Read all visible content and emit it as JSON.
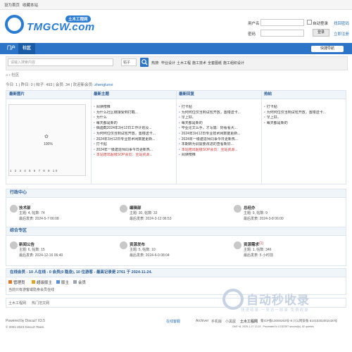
{
  "topbar": {
    "set_home": "设为首页",
    "bookmark": "收藏本站"
  },
  "logo": {
    "text": "TMGCW.com",
    "badge": "土木工程网"
  },
  "login": {
    "username_label": "用户名",
    "password_label": "密码",
    "auto_login": "自动登录",
    "find_password": "找回密码",
    "login_button": "登录",
    "register": "立即注册"
  },
  "nav": {
    "items": [
      "门户",
      "社区"
    ],
    "active": 1,
    "quick_nav": "快捷导航"
  },
  "search": {
    "placeholder": "请输入搜索内容",
    "select_value": "帖子",
    "hot_label": "热搜:",
    "hot_terms": [
      "毕业设计",
      "土木工程",
      "施工技术",
      "全套图纸",
      "施工组织设计"
    ]
  },
  "breadcrumb": {
    "current": "社区"
  },
  "stats": {
    "text": "今日: 1 | 昨日: 0 | 帖子: 493 | 会员: 34 | 欢迎新会员: ",
    "new_member": "zhenglunvi"
  },
  "top_panel": {
    "columns": [
      "最新图片",
      "最新主题",
      "最新回复",
      "热帖"
    ],
    "image_percent": "100%",
    "image_pages": "1 2 3 4 5 6 7 8 9 10",
    "latest_topics": [
      {
        "text": "阅读榜推",
        "red": false
      },
      {
        "text": "为什么社区链接受到打截...",
        "red": false
      },
      {
        "text": "为什么",
        "red": false
      },
      {
        "text": "每天都是新的",
        "red": false
      },
      {
        "text": "偶遇截2024年3月12日工作计划及...",
        "red": false
      },
      {
        "text": "为何何位仅当到试包开放，置楼送卡...",
        "red": false
      },
      {
        "text": "2024年3月12日专业技术网数据更新...",
        "red": false
      },
      {
        "text": "打卡贴",
        "red": false
      },
      {
        "text": "2024年一级建造师同事今日更新热...",
        "red": false
      },
      {
        "text": "本站陪出超级SOP会员：全站资源...",
        "red": true
      }
    ],
    "latest_replies": [
      {
        "text": "打卡贴",
        "red": false
      },
      {
        "text": "为何何位仅当到试包开放，置楼送卡...",
        "red": false
      },
      {
        "text": "早上好。",
        "red": false
      },
      {
        "text": "每天都是新的",
        "red": false
      },
      {
        "text": "毕业论文么手，才写篇：好看看大...",
        "red": false
      },
      {
        "text": "2024年3月12日专业技术网数据更新...",
        "red": false
      },
      {
        "text": "2024年一级建造师同事今日更新热...",
        "red": false
      },
      {
        "text": "本期转为调需要改进的查看新好...",
        "red": false
      },
      {
        "text": "本站陪出超级SOP会员：全站资源...",
        "red": true
      },
      {
        "text": "阅读榜推",
        "red": false
      }
    ],
    "hot_threads": [
      {
        "text": "打卡贴",
        "red": false
      },
      {
        "text": "为何何位仅当到试包开放，置楼送卡...",
        "red": false
      },
      {
        "text": "早上好。",
        "red": false
      },
      {
        "text": "每天都是新的",
        "red": false
      }
    ]
  },
  "section1": {
    "title": "行政中心",
    "forums": [
      {
        "name": "技术部",
        "meta1": "主题: 4, 帖数: 74",
        "meta2": "最后发表: 2024-5-7 06:08"
      },
      {
        "name": "编辑部",
        "meta1": "主题: 30, 帖数: 33",
        "meta2": "最后发表: 2024-3-12 06:53"
      },
      {
        "name": "总经办",
        "meta1": "主题: 9, 帖数: 9",
        "meta2": "最后发表: 2024-3-8 06:00"
      }
    ]
  },
  "section2": {
    "title": "综合专区",
    "forums": [
      {
        "name": "新闻公告",
        "meta1": "主题: 6, 帖数: 15",
        "meta2": "最后发表: 2024-12-16 06:40",
        "extra": ""
      },
      {
        "name": "资源发布",
        "meta1": "主题: 5, 帖数: 10",
        "meta2": "最后发表: 2024-6-9 08:04",
        "extra": ""
      },
      {
        "name": "资源需求",
        "meta1": "主题: 1, 帖数: 346",
        "meta2": "最后发表: 5 小时前",
        "extra": "(1)"
      }
    ]
  },
  "online": {
    "title": "在线会员 - 10 人在线 - 0 会员(0 隐身), 10 位游客 - 最高记录是 2761 于 2024-11-24.",
    "groups": [
      "管理员",
      "超级版主",
      "版主",
      "会员"
    ],
    "group_colors": [
      "#e07a2a",
      "#e0a42a",
      "#5a8ed6",
      "#9aa4b0"
    ],
    "note": "当前只有游客或隐身会员在线"
  },
  "links": {
    "items": [
      "土木工程网",
      "热门范文网"
    ]
  },
  "footer": {
    "powered": "Powered by Discuz! X3.5",
    "copyright": "© 2001-2023 Discuz! Team.",
    "archiver": "Archiver",
    "mobile": "手机版",
    "dark": "小黑屋",
    "site": "土木工程网",
    "icp": "蜀ICP备13000263号-8",
    "police": "川公网安备 51010302002430号",
    "online_msg": "在线客服",
    "time_info": "GMT+8, 2025-1-27 13:24 , Processed in 0.032397 second(s), 82 queries"
  },
  "watermark": {
    "title": "自动秒收录",
    "sub": "快速收录·一来访一收录·免费收录"
  }
}
